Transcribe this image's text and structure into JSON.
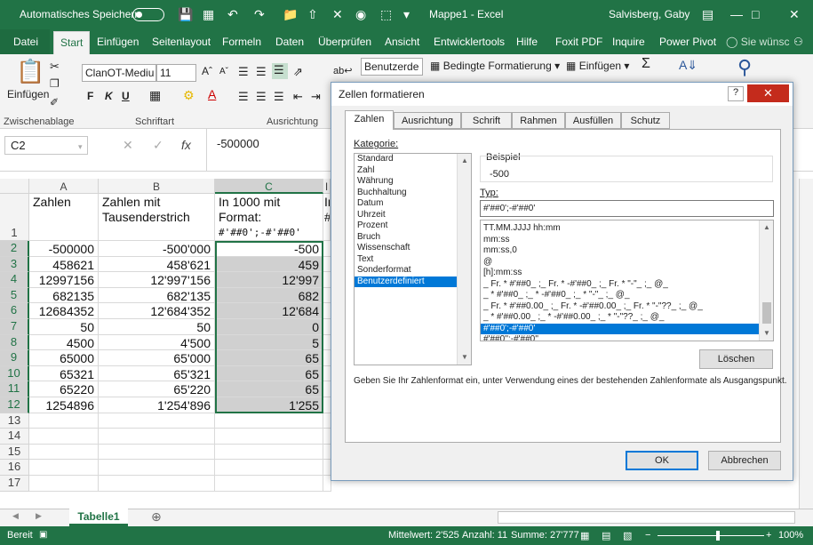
{
  "titlebar": {
    "autosave": "Automatisches Speichern",
    "doc_title": "Mappe1  -  Excel",
    "user": "Salvisberg, Gaby"
  },
  "menu": {
    "file": "Datei",
    "tabs": [
      "Start",
      "Einfügen",
      "Seitenlayout",
      "Formeln",
      "Daten",
      "Überprüfen",
      "Ansicht",
      "Entwicklertools",
      "Hilfe",
      "Foxit PDF",
      "Inquire",
      "Power Pivot"
    ],
    "search": "Sie wünsc"
  },
  "ribbon": {
    "paste": "Einfügen",
    "font_name": "ClanOT-Mediu",
    "font_size": "11",
    "bold": "F",
    "italic": "K",
    "underline": "U",
    "number_format": "Benutzerde",
    "cond_format": "Bedingte Formatierung",
    "insert_cells": "Einfügen",
    "groups": {
      "clipboard": "Zwischenablage",
      "font": "Schriftart",
      "alignment": "Ausrichtung"
    }
  },
  "formula_bar": {
    "cell_ref": "C2",
    "fx": "fx",
    "value": "-500000"
  },
  "sheet": {
    "columns": [
      "A",
      "B",
      "C",
      "I"
    ],
    "header_row": {
      "a": "Zahlen",
      "b": [
        "Zahlen mit",
        "Tausenderstrich"
      ],
      "c": [
        "In 1000 mit",
        "Format:",
        "#'##0';-#'##0'"
      ],
      "d": [
        "In",
        "#"
      ]
    },
    "rows": [
      {
        "n": "2",
        "a": "-500000",
        "b": "-500'000",
        "c": "-500"
      },
      {
        "n": "3",
        "a": "458621",
        "b": "458'621",
        "c": "459"
      },
      {
        "n": "4",
        "a": "12997156",
        "b": "12'997'156",
        "c": "12'997"
      },
      {
        "n": "5",
        "a": "682135",
        "b": "682'135",
        "c": "682"
      },
      {
        "n": "6",
        "a": "12684352",
        "b": "12'684'352",
        "c": "12'684"
      },
      {
        "n": "7",
        "a": "50",
        "b": "50",
        "c": "0"
      },
      {
        "n": "8",
        "a": "4500",
        "b": "4'500",
        "c": "5"
      },
      {
        "n": "9",
        "a": "65000",
        "b": "65'000",
        "c": "65"
      },
      {
        "n": "10",
        "a": "65321",
        "b": "65'321",
        "c": "65"
      },
      {
        "n": "11",
        "a": "65220",
        "b": "65'220",
        "c": "65"
      },
      {
        "n": "12",
        "a": "1254896",
        "b": "1'254'896",
        "c": "1'255"
      }
    ],
    "empty_rows": [
      "13",
      "14",
      "15",
      "16",
      "17"
    ],
    "first_row": "1",
    "tab_name": "Tabelle1"
  },
  "status": {
    "ready": "Bereit",
    "avg": "Mittelwert: 2'525",
    "count": "Anzahl: 11",
    "sum": "Summe: 27'777",
    "zoom": "100%"
  },
  "dialog": {
    "title": "Zellen formatieren",
    "help": "?",
    "tabs": [
      "Zahlen",
      "Ausrichtung",
      "Schrift",
      "Rahmen",
      "Ausfüllen",
      "Schutz"
    ],
    "category_label": "Kategorie:",
    "categories": [
      "Standard",
      "Zahl",
      "Währung",
      "Buchhaltung",
      "Datum",
      "Uhrzeit",
      "Prozent",
      "Bruch",
      "Wissenschaft",
      "Text",
      "Sonderformat",
      "Benutzerdefiniert"
    ],
    "sample_label": "Beispiel",
    "sample_value": "-500",
    "type_label": "Typ:",
    "type_value": "#'##0';-#'##0'",
    "type_list": [
      "TT.MM.JJJJ hh:mm",
      "mm:ss",
      "mm:ss,0",
      "@",
      "[h]:mm:ss",
      "_ Fr. * #'##0_ ;_ Fr. * -#'##0_ ;_ Fr. * \"-\"_ ;_ @_",
      "_ * #'##0_ ;_ * -#'##0_ ;_ * \"-\"_ ;_ @_",
      "_ Fr. * #'##0.00_ ;_ Fr. * -#'##0.00_ ;_ Fr. * \"-\"??_ ;_ @_",
      "_ * #'##0.00_ ;_ * -#'##0.00_ ;_ * \"-\"??_ ;_ @_",
      "#'##0';-#'##0'",
      "#'##0'';-#'##0''"
    ],
    "delete": "Löschen",
    "hint": "Geben Sie Ihr Zahlenformat ein, unter Verwendung eines der bestehenden Zahlenformate als Ausgangspunkt.",
    "ok": "OK",
    "cancel": "Abbrechen"
  }
}
